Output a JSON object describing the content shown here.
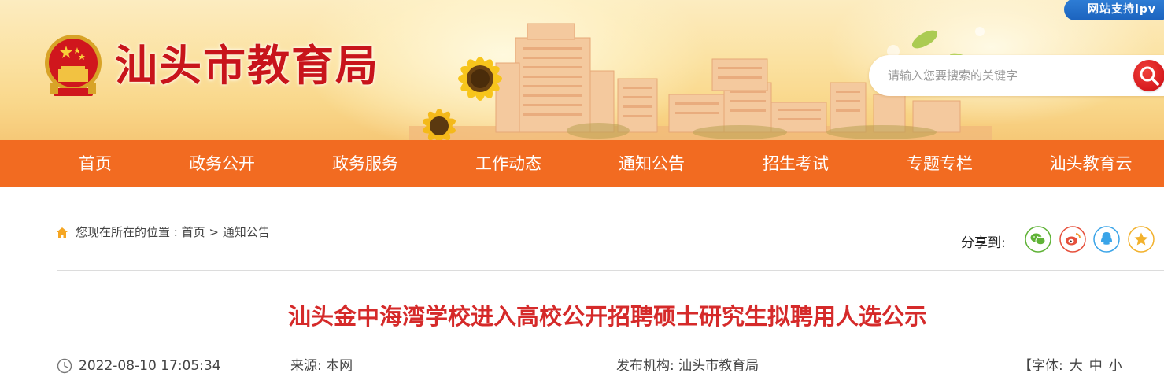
{
  "header": {
    "site_title": "汕头市教育局",
    "ipv6_badge": "网站支持ipv",
    "search_placeholder": "请输入您要搜索的关键字"
  },
  "nav": {
    "items": [
      "首页",
      "政务公开",
      "政务服务",
      "工作动态",
      "通知公告",
      "招生考试",
      "专题专栏",
      "汕头教育云"
    ]
  },
  "breadcrumb": {
    "prefix": "您现在所在的位置 : ",
    "home": "首页",
    "separator": " > ",
    "current": "通知公告"
  },
  "share": {
    "label": "分享到:",
    "targets": [
      "wechat",
      "weibo",
      "qq",
      "qzone"
    ]
  },
  "article": {
    "title": "汕头金中海湾学校进入高校公开招聘硕士研究生拟聘用人选公示",
    "datetime": "2022-08-10 17:05:34",
    "source": "来源:  本网",
    "publisher": "发布机构: 汕头市教育局",
    "font_label": "【字体:",
    "font_large": "大",
    "font_medium": "中",
    "font_small": "小"
  },
  "colors": {
    "nav_bg": "#f26b21",
    "title_red": "#d52a2a",
    "site_title_red": "#c8141b",
    "ipv6_blue": "#1b63be",
    "wechat_green": "#5fb236",
    "weibo_red": "#e6503c",
    "qq_blue": "#3aa4e8",
    "qzone_gold": "#f2b12c"
  },
  "icons": [
    "national-emblem-icon",
    "search-icon",
    "home-icon",
    "wechat-icon",
    "weibo-icon",
    "qq-icon",
    "qzone-star-icon",
    "clock-icon"
  ]
}
